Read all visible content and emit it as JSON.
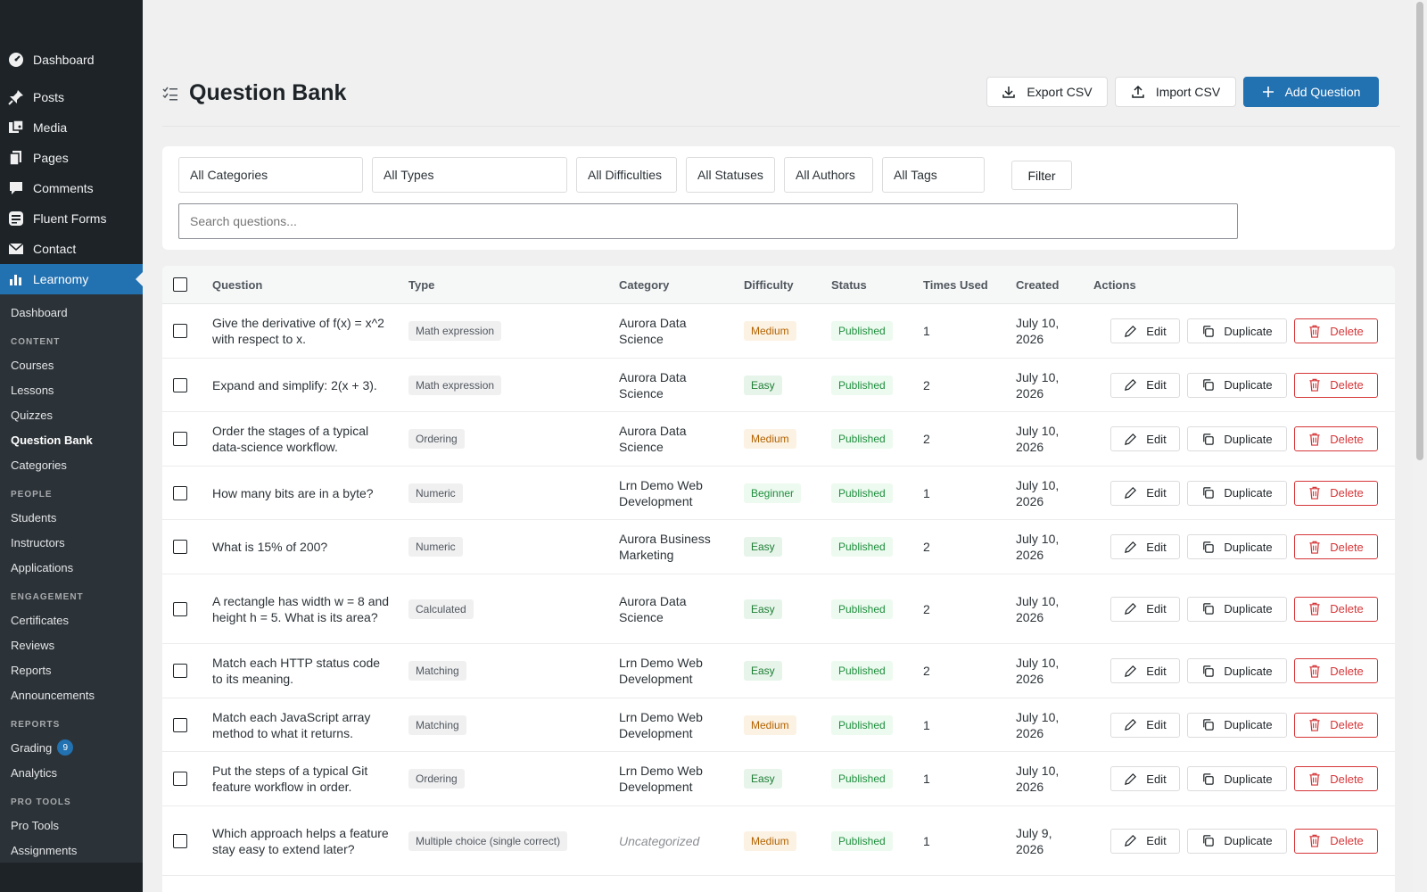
{
  "sidebar": {
    "top_items": [
      {
        "label": "Dashboard",
        "icon": "dashboard-icon"
      },
      {
        "label": "Posts",
        "icon": "pin-icon"
      },
      {
        "label": "Media",
        "icon": "media-icon"
      },
      {
        "label": "Pages",
        "icon": "pages-icon"
      },
      {
        "label": "Comments",
        "icon": "comment-icon"
      },
      {
        "label": "Fluent Forms",
        "icon": "forms-icon"
      },
      {
        "label": "Contact",
        "icon": "mail-icon"
      },
      {
        "label": "Learnomy",
        "icon": "chart-icon"
      }
    ],
    "sub_dashboard": "Dashboard",
    "sections": [
      {
        "heading": "CONTENT",
        "items": [
          "Courses",
          "Lessons",
          "Quizzes",
          "Question Bank",
          "Categories"
        ]
      },
      {
        "heading": "PEOPLE",
        "items": [
          "Students",
          "Instructors",
          "Applications"
        ]
      },
      {
        "heading": "ENGAGEMENT",
        "items": [
          "Certificates",
          "Reviews",
          "Reports",
          "Announcements"
        ]
      },
      {
        "heading": "REPORTS",
        "items": [
          "Grading",
          "Analytics"
        ]
      },
      {
        "heading": "PRO TOOLS",
        "items": [
          "Pro Tools",
          "Assignments"
        ]
      }
    ],
    "grading_badge": "9",
    "current_item": "Question Bank"
  },
  "header": {
    "title": "Question Bank",
    "export_label": "Export CSV",
    "import_label": "Import CSV",
    "add_label": "Add Question"
  },
  "filters": {
    "categories": "All Categories",
    "types": "All Types",
    "difficulties": "All Difficulties",
    "statuses": "All Statuses",
    "authors": "All Authors",
    "tags": "All Tags",
    "filter_label": "Filter",
    "search_placeholder": "Search questions..."
  },
  "table": {
    "columns": {
      "question": "Question",
      "type": "Type",
      "category": "Category",
      "difficulty": "Difficulty",
      "status": "Status",
      "times_used": "Times Used",
      "created": "Created",
      "actions": "Actions"
    },
    "actions": {
      "edit": "Edit",
      "duplicate": "Duplicate",
      "delete": "Delete"
    },
    "rows": [
      {
        "question": "Give the derivative of f(x) = x^2 with respect to x.",
        "type": "Math expression",
        "category": "Aurora Data Science",
        "difficulty": "Medium",
        "status": "Published",
        "times_used": "1",
        "created": "July 10, 2026"
      },
      {
        "question": "Expand and simplify: 2(x + 3).",
        "type": "Math expression",
        "category": "Aurora Data Science",
        "difficulty": "Easy",
        "status": "Published",
        "times_used": "2",
        "created": "July 10, 2026"
      },
      {
        "question": "Order the stages of a typical data-science workflow.",
        "type": "Ordering",
        "category": "Aurora Data Science",
        "difficulty": "Medium",
        "status": "Published",
        "times_used": "2",
        "created": "July 10, 2026"
      },
      {
        "question": "How many bits are in a byte?",
        "type": "Numeric",
        "category": "Lrn Demo Web Development",
        "difficulty": "Beginner",
        "status": "Published",
        "times_used": "1",
        "created": "July 10, 2026"
      },
      {
        "question": "What is 15% of 200?",
        "type": "Numeric",
        "category": "Aurora Business Marketing",
        "difficulty": "Easy",
        "status": "Published",
        "times_used": "2",
        "created": "July 10, 2026"
      },
      {
        "question": "A rectangle has width w = 8 and height h = 5. What is its area?",
        "type": "Calculated",
        "category": "Aurora Data Science",
        "difficulty": "Easy",
        "status": "Published",
        "times_used": "2",
        "created": "July 10, 2026"
      },
      {
        "question": "Match each HTTP status code to its meaning.",
        "type": "Matching",
        "category": "Lrn Demo Web Development",
        "difficulty": "Easy",
        "status": "Published",
        "times_used": "2",
        "created": "July 10, 2026"
      },
      {
        "question": "Match each JavaScript array method to what it returns.",
        "type": "Matching",
        "category": "Lrn Demo Web Development",
        "difficulty": "Medium",
        "status": "Published",
        "times_used": "1",
        "created": "July 10, 2026"
      },
      {
        "question": "Put the steps of a typical Git feature workflow in order.",
        "type": "Ordering",
        "category": "Lrn Demo Web Development",
        "difficulty": "Easy",
        "status": "Published",
        "times_used": "1",
        "created": "July 10, 2026"
      },
      {
        "question": "Which approach helps a feature stay easy to extend later?",
        "type": "Multiple choice (single correct)",
        "category": "Uncategorized",
        "difficulty": "Medium",
        "status": "Published",
        "times_used": "1",
        "created": "July 9, 2026"
      }
    ]
  },
  "colors": {
    "sidebar_bg": "#1d2327",
    "accent": "#2271b1",
    "delete": "#d63638",
    "status_published": "#1e8e3e",
    "difficulty_medium": "#b26200"
  }
}
